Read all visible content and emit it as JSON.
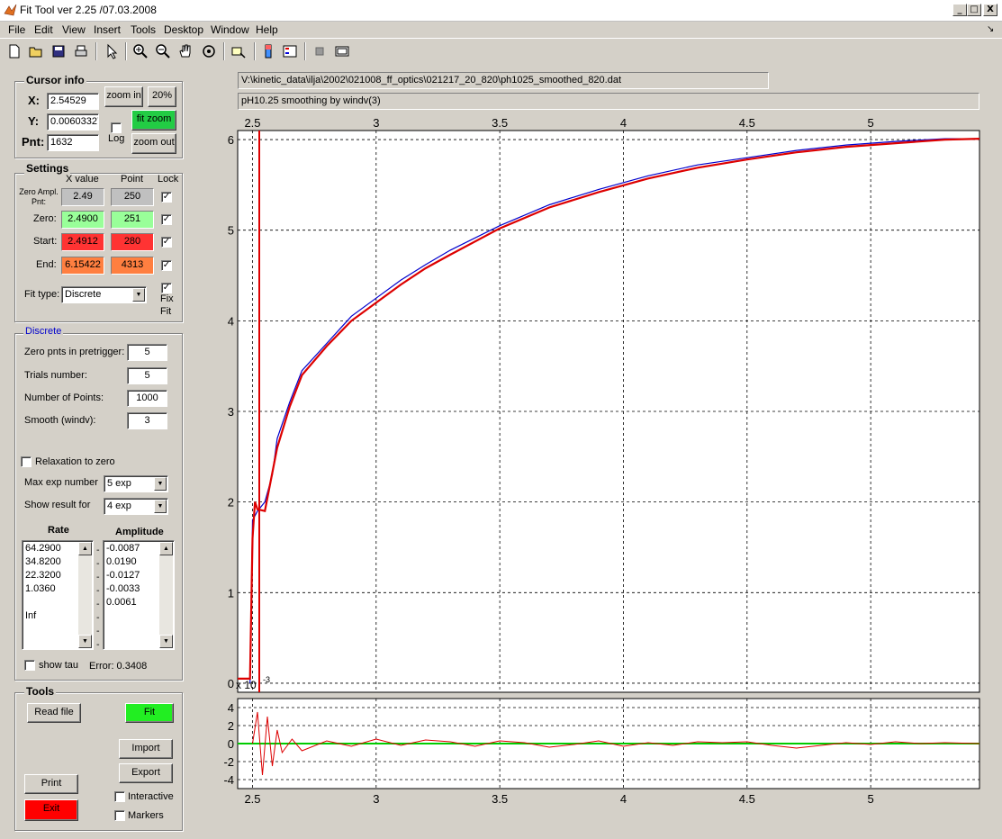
{
  "window": {
    "title": "Fit Tool ver 2.25 /07.03.2008",
    "controls": [
      "_",
      "□",
      "X"
    ]
  },
  "menu": [
    "File",
    "Edit",
    "View",
    "Insert",
    "Tools",
    "Desktop",
    "Window",
    "Help"
  ],
  "toolbar_icons": [
    "new-file-icon",
    "open-folder-icon",
    "save-icon",
    "print-icon",
    "pointer-icon",
    "zoom-in-icon",
    "zoom-out-icon",
    "pan-hand-icon",
    "rotate-icon",
    "data-cursor-icon",
    "colorbar-icon",
    "legend-icon",
    "hide-plot-tools-icon",
    "show-plot-tools-icon"
  ],
  "cursor_info": {
    "title": "Cursor info",
    "x_label": "X:",
    "x_value": "2.54529",
    "y_label": "Y:",
    "y_value": "0.00603327",
    "pnt_label": "Pnt:",
    "pnt_value": "1632",
    "zoom_in": "zoom in",
    "pct": "20%",
    "fit_zoom": "fit zoom",
    "zoom_out": "zoom out",
    "log_label": "Log",
    "log_checked": false
  },
  "settings": {
    "title": "Settings",
    "col_x": "X value",
    "col_point": "Point",
    "col_lock": "Lock",
    "rows": [
      {
        "label": "Zero Ampl. Pnt:",
        "x": "2.49",
        "point": "250",
        "locked": true,
        "color": "#c0c0c0"
      },
      {
        "label": "Zero:",
        "x": "2.4900",
        "point": "251",
        "locked": true,
        "color": "#99ff99"
      },
      {
        "label": "Start:",
        "x": "2.4912",
        "point": "280",
        "locked": true,
        "color": "#ff3333"
      },
      {
        "label": "End:",
        "x": "6.15422",
        "point": "4313",
        "locked": true,
        "color": "#ff7f40"
      }
    ],
    "fit_type_label": "Fit type:",
    "fit_type_value": "Discrete",
    "fix_fit_label_1": "Fix",
    "fix_fit_label_2": "Fit",
    "fix_fit_checked": true
  },
  "discrete": {
    "title": "Discrete",
    "zero_pnts_label": "Zero pnts in pretrigger:",
    "zero_pnts_value": "5",
    "trials_label": "Trials number:",
    "trials_value": "5",
    "npoints_label": "Number of Points:",
    "npoints_value": "1000",
    "smooth_label": "Smooth (windv):",
    "smooth_value": "3",
    "relax_label": "Relaxation to zero",
    "relax_checked": false,
    "max_exp_label": "Max exp number",
    "max_exp_value": "5 exp",
    "show_result_label": "Show result for",
    "show_result_value": "4 exp",
    "rate_header": "Rate",
    "amp_header": "Amplitude",
    "rates": [
      "64.2900",
      "34.8200",
      "22.3200",
      "1.0360",
      "",
      "Inf"
    ],
    "amplitudes": [
      "-0.0087",
      "0.0190",
      "-0.0127",
      "-0.0033",
      "0.0061"
    ],
    "dash": "-",
    "show_tau_label": "show tau",
    "show_tau_checked": false,
    "error_text": "Error: 0.3408"
  },
  "tools": {
    "title": "Tools",
    "read_file": "Read file",
    "fit": "Fit",
    "import": "Import",
    "export": "Export",
    "print": "Print",
    "exit": "Exit",
    "interactive_label": "Interactive",
    "markers_label": "Markers"
  },
  "file_path": "V:\\kinetic_data\\ilja\\2002\\021008_ff_optics\\021217_20_820\\ph1025_smoothed_820.dat",
  "description": "pH10.25 smoothing by windv(3)",
  "main_axes": {
    "x_ticks": [
      "2.5",
      "3",
      "3.5",
      "4",
      "4.5",
      "5"
    ],
    "y_ticks": [
      "0",
      "1",
      "2",
      "3",
      "4",
      "5",
      "6"
    ],
    "exponent_label": "x 10",
    "exponent_power": "-3"
  },
  "resid_axes": {
    "x_ticks": [
      "2.5",
      "3",
      "3.5",
      "4",
      "4.5",
      "5"
    ],
    "y_ticks": [
      "4",
      "2",
      "0",
      "-2",
      "-4"
    ]
  },
  "colors": {
    "data_line": "#0000cc",
    "fit_line": "#dd0000",
    "zero_line": "#00cc00",
    "fit_button": "#22ee22",
    "exit_button": "#ff0000",
    "fit_zoom_button": "#22cc44"
  },
  "chart_data": {
    "type": "line",
    "x_range": [
      2.44,
      5.44
    ],
    "y_range": [
      -0.1,
      6.1
    ],
    "series": [
      {
        "color": "#0000cc",
        "x": [
          2.49,
          2.5,
          2.52,
          2.55,
          2.58,
          2.6,
          2.65,
          2.7,
          2.8,
          2.9,
          3.0,
          3.1,
          3.2,
          3.3,
          3.5,
          3.7,
          3.9,
          4.1,
          4.3,
          4.5,
          4.7,
          4.9,
          5.1,
          5.3,
          5.44
        ],
        "y": [
          0.0,
          1.8,
          1.9,
          2.0,
          2.3,
          2.7,
          3.1,
          3.45,
          3.75,
          4.05,
          4.25,
          4.45,
          4.62,
          4.78,
          5.05,
          5.28,
          5.45,
          5.6,
          5.72,
          5.8,
          5.88,
          5.94,
          5.98,
          6.01,
          6.01
        ]
      },
      {
        "color": "#dd0000",
        "x": [
          2.44,
          2.49,
          2.5,
          2.51,
          2.52,
          2.55,
          2.6,
          2.65,
          2.7,
          2.8,
          2.9,
          3.0,
          3.1,
          3.2,
          3.3,
          3.5,
          3.7,
          3.9,
          4.1,
          4.3,
          4.5,
          4.7,
          4.9,
          5.1,
          5.3,
          5.44
        ],
        "y": [
          0.05,
          0.05,
          1.6,
          2.0,
          1.92,
          1.9,
          2.6,
          3.05,
          3.4,
          3.72,
          4.0,
          4.2,
          4.4,
          4.58,
          4.73,
          5.02,
          5.25,
          5.42,
          5.57,
          5.69,
          5.78,
          5.86,
          5.92,
          5.96,
          6.0,
          6.01
        ]
      }
    ],
    "residuals": {
      "color": "#dd0000",
      "y_range": [
        -5,
        5
      ],
      "x": [
        2.5,
        2.52,
        2.54,
        2.56,
        2.58,
        2.6,
        2.62,
        2.66,
        2.7,
        2.8,
        2.9,
        3.0,
        3.1,
        3.2,
        3.3,
        3.4,
        3.5,
        3.6,
        3.7,
        3.8,
        3.9,
        4.0,
        4.1,
        4.2,
        4.3,
        4.4,
        4.5,
        4.6,
        4.7,
        4.8,
        4.9,
        5.0,
        5.1,
        5.2,
        5.3,
        5.44
      ],
      "y": [
        0,
        3.5,
        -3.5,
        3,
        -2.5,
        1.5,
        -1,
        0.5,
        -0.8,
        0.3,
        -0.3,
        0.5,
        -0.2,
        0.4,
        0.2,
        -0.3,
        0.3,
        0.1,
        -0.4,
        -0.1,
        0.3,
        -0.3,
        0.1,
        -0.2,
        0.2,
        0.1,
        0.2,
        -0.2,
        -0.5,
        -0.2,
        0.1,
        -0.1,
        0.2,
        0.0,
        0.1,
        0.0
      ]
    }
  }
}
